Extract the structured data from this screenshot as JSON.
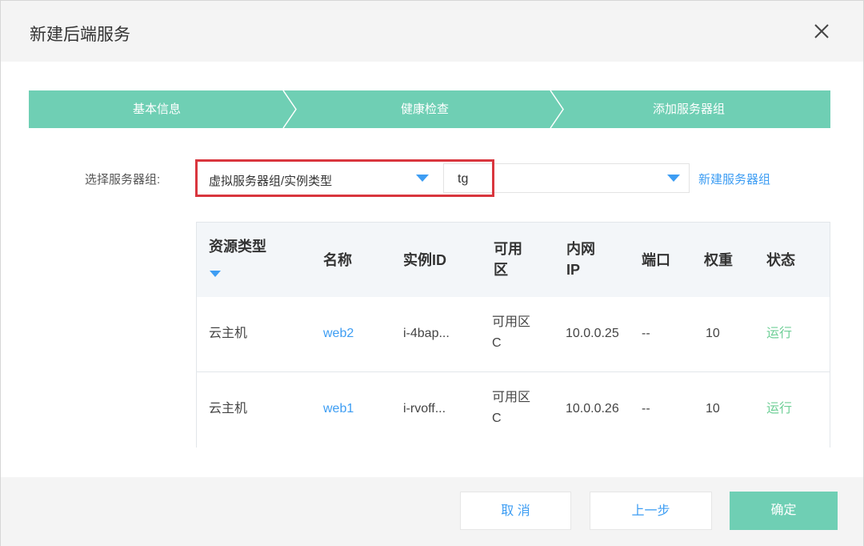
{
  "dialog": {
    "title": "新建后端服务"
  },
  "steps": [
    {
      "label": "基本信息"
    },
    {
      "label": "健康检查"
    },
    {
      "label": "添加服务器组"
    }
  ],
  "group_select": {
    "label": "选择服务器组:",
    "type_value": "虚拟服务器组/实例类型",
    "group_value": "tg",
    "new_group_link": "新建服务器组"
  },
  "table": {
    "headers": {
      "resource_type": "资源类型",
      "name": "名称",
      "instance_id": "实例ID",
      "zone_l1": "可用",
      "zone_l2": "区",
      "ip_l1": "内网",
      "ip_l2": "IP",
      "port": "端口",
      "weight": "权重",
      "status": "状态"
    },
    "rows": [
      {
        "resource_type": "云主机",
        "name": "web2",
        "instance_id": "i-4bap...",
        "zone_l1": "可用区",
        "zone_l2": "C",
        "ip": "10.0.0.25",
        "port": "--",
        "weight": "10",
        "status": "运行"
      },
      {
        "resource_type": "云主机",
        "name": "web1",
        "instance_id": "i-rvoff...",
        "zone_l1": "可用区",
        "zone_l2": "C",
        "ip": "10.0.0.26",
        "port": "--",
        "weight": "10",
        "status": "运行"
      }
    ]
  },
  "footer": {
    "cancel": "取 消",
    "prev": "上一步",
    "ok": "确定"
  },
  "colors": {
    "accent": "#6fcfb4",
    "link": "#3d9df3",
    "highlight_frame": "#d9363e"
  },
  "icons": {
    "close": "close-icon",
    "dropdown": "triangle-down-icon",
    "sort": "sort-down-icon"
  }
}
